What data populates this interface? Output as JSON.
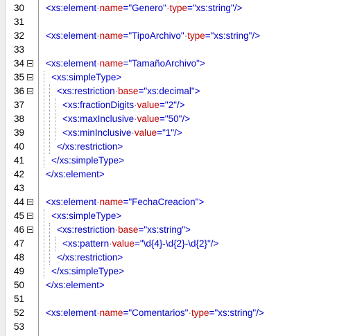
{
  "editor": {
    "colors": {
      "tag": "#0000c8",
      "attribute": "#c00000",
      "value": "#0000c8",
      "line_number": "#000000"
    },
    "lines": [
      {
        "n": "30",
        "fold": false,
        "indent": 0,
        "parts": [
          {
            "t": "<xs:element",
            "c": "tg"
          },
          {
            "t": "·",
            "c": "dt"
          },
          {
            "t": "name",
            "c": "at"
          },
          {
            "t": "=\"Genero\"",
            "c": "vl"
          },
          {
            "t": "·",
            "c": "dt"
          },
          {
            "t": "type",
            "c": "at"
          },
          {
            "t": "=\"xs:string\"/>",
            "c": "vl"
          }
        ]
      },
      {
        "n": "31",
        "fold": false,
        "indent": 0,
        "parts": []
      },
      {
        "n": "32",
        "fold": false,
        "indent": 0,
        "parts": [
          {
            "t": "<xs:element",
            "c": "tg"
          },
          {
            "t": "·",
            "c": "dt"
          },
          {
            "t": "name",
            "c": "at"
          },
          {
            "t": "=\"TipoArchivo\"",
            "c": "vl"
          },
          {
            "t": "·",
            "c": "dt"
          },
          {
            "t": "type",
            "c": "at"
          },
          {
            "t": "=\"xs:string\"/>",
            "c": "vl"
          }
        ]
      },
      {
        "n": "33",
        "fold": false,
        "indent": 0,
        "parts": []
      },
      {
        "n": "34",
        "fold": true,
        "indent": 0,
        "parts": [
          {
            "t": "<xs:element",
            "c": "tg"
          },
          {
            "t": "·",
            "c": "dt"
          },
          {
            "t": "name",
            "c": "at"
          },
          {
            "t": "=\"TamañoArchivo\">",
            "c": "vl"
          }
        ]
      },
      {
        "n": "35",
        "fold": true,
        "indent": 1,
        "parts": [
          {
            "t": "<xs:simpleType>",
            "c": "tg"
          }
        ]
      },
      {
        "n": "36",
        "fold": true,
        "indent": 2,
        "parts": [
          {
            "t": "<xs:restriction",
            "c": "tg"
          },
          {
            "t": "·",
            "c": "dt"
          },
          {
            "t": "base",
            "c": "at"
          },
          {
            "t": "=\"xs:decimal\">",
            "c": "vl"
          }
        ]
      },
      {
        "n": "37",
        "fold": false,
        "indent": 3,
        "parts": [
          {
            "t": "<xs:fractionDigits",
            "c": "tg"
          },
          {
            "t": "·",
            "c": "dt"
          },
          {
            "t": "value",
            "c": "at"
          },
          {
            "t": "=\"2\"/>",
            "c": "vl"
          }
        ]
      },
      {
        "n": "38",
        "fold": false,
        "indent": 3,
        "parts": [
          {
            "t": "<xs:maxInclusive",
            "c": "tg"
          },
          {
            "t": "·",
            "c": "dt"
          },
          {
            "t": "value",
            "c": "at"
          },
          {
            "t": "=\"50\"/>",
            "c": "vl"
          }
        ]
      },
      {
        "n": "39",
        "fold": false,
        "indent": 3,
        "parts": [
          {
            "t": "<xs:minInclusive",
            "c": "tg"
          },
          {
            "t": "·",
            "c": "dt"
          },
          {
            "t": "value",
            "c": "at"
          },
          {
            "t": "=\"1\"/>",
            "c": "vl"
          }
        ]
      },
      {
        "n": "40",
        "fold": false,
        "indent": 2,
        "parts": [
          {
            "t": "</xs:restriction>",
            "c": "tg"
          }
        ]
      },
      {
        "n": "41",
        "fold": false,
        "indent": 1,
        "parts": [
          {
            "t": "</xs:simpleType>",
            "c": "tg"
          }
        ]
      },
      {
        "n": "42",
        "fold": false,
        "indent": 0,
        "parts": [
          {
            "t": "</xs:element>",
            "c": "tg"
          }
        ]
      },
      {
        "n": "43",
        "fold": false,
        "indent": 0,
        "parts": []
      },
      {
        "n": "44",
        "fold": true,
        "indent": 0,
        "parts": [
          {
            "t": "<xs:element",
            "c": "tg"
          },
          {
            "t": "·",
            "c": "dt"
          },
          {
            "t": "name",
            "c": "at"
          },
          {
            "t": "=\"FechaCreacion\">",
            "c": "vl"
          }
        ]
      },
      {
        "n": "45",
        "fold": true,
        "indent": 1,
        "parts": [
          {
            "t": "<xs:simpleType>",
            "c": "tg"
          }
        ]
      },
      {
        "n": "46",
        "fold": true,
        "indent": 2,
        "parts": [
          {
            "t": "<xs:restriction",
            "c": "tg"
          },
          {
            "t": "·",
            "c": "dt"
          },
          {
            "t": "base",
            "c": "at"
          },
          {
            "t": "=\"xs:string\">",
            "c": "vl"
          }
        ]
      },
      {
        "n": "47",
        "fold": false,
        "indent": 3,
        "parts": [
          {
            "t": "<xs:pattern",
            "c": "tg"
          },
          {
            "t": "·",
            "c": "dt"
          },
          {
            "t": "value",
            "c": "at"
          },
          {
            "t": "=\"\\d{4}-\\d{2}-\\d{2}\"/>",
            "c": "vl"
          }
        ]
      },
      {
        "n": "48",
        "fold": false,
        "indent": 2,
        "parts": [
          {
            "t": "</xs:restriction>",
            "c": "tg"
          }
        ]
      },
      {
        "n": "49",
        "fold": false,
        "indent": 1,
        "parts": [
          {
            "t": "</xs:simpleType>",
            "c": "tg"
          }
        ]
      },
      {
        "n": "50",
        "fold": false,
        "indent": 0,
        "parts": [
          {
            "t": "</xs:element>",
            "c": "tg"
          }
        ]
      },
      {
        "n": "51",
        "fold": false,
        "indent": 0,
        "parts": []
      },
      {
        "n": "52",
        "fold": false,
        "indent": 0,
        "parts": [
          {
            "t": "<xs:element",
            "c": "tg"
          },
          {
            "t": "·",
            "c": "dt"
          },
          {
            "t": "name",
            "c": "at"
          },
          {
            "t": "=\"Comentarios\"",
            "c": "vl"
          },
          {
            "t": "·",
            "c": "dt"
          },
          {
            "t": "type",
            "c": "at"
          },
          {
            "t": "=\"xs:string\"/>",
            "c": "vl"
          }
        ]
      },
      {
        "n": "53",
        "fold": false,
        "indent": 0,
        "parts": []
      }
    ]
  }
}
